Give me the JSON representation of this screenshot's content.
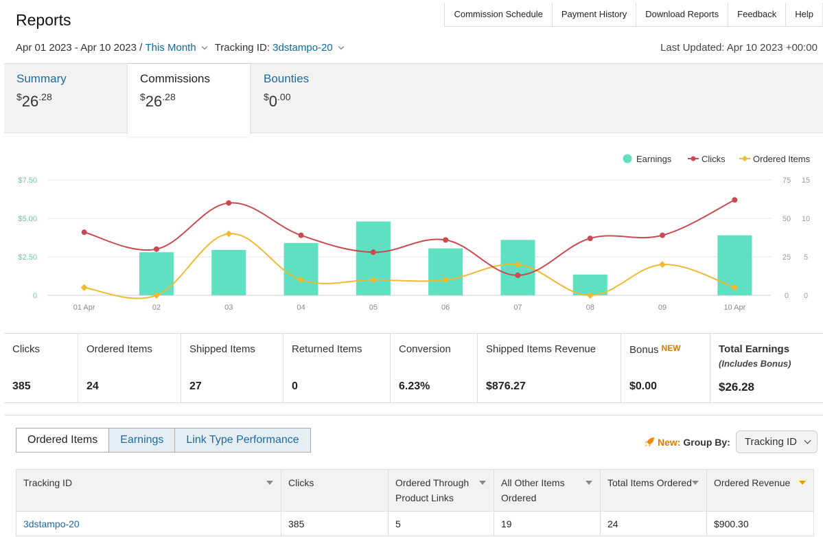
{
  "header": {
    "title": "Reports",
    "nav": [
      "Commission Schedule",
      "Payment History",
      "Download Reports",
      "Feedback",
      "Help"
    ],
    "date_range": "Apr 01 2023 - Apr 10 2023 /",
    "period": "This Month",
    "tracking_label": "Tracking ID:",
    "tracking_value": "3dstampo-20",
    "last_updated": "Last Updated: Apr 10 2023 +00:00"
  },
  "summary_tabs": [
    {
      "label": "Summary",
      "currency": "$",
      "whole": "26",
      "cents": ".28"
    },
    {
      "label": "Commissions",
      "currency": "$",
      "whole": "26",
      "cents": ".28"
    },
    {
      "label": "Bounties",
      "currency": "$",
      "whole": "0",
      "cents": ".00"
    }
  ],
  "chart_data": {
    "type": "bar",
    "categories": [
      "01 Apr",
      "02",
      "03",
      "04",
      "05",
      "06",
      "07",
      "08",
      "09",
      "10 Apr"
    ],
    "legend": [
      "Earnings",
      "Clicks",
      "Ordered Items"
    ],
    "left_axis_ticks": [
      "$7.50",
      "$5.00",
      "$2.50",
      "0"
    ],
    "mid_axis_ticks": [
      "75",
      "50",
      "25",
      "0"
    ],
    "right_axis_ticks": [
      "15",
      "10",
      "5",
      "0"
    ],
    "series": [
      {
        "name": "Earnings",
        "axis": "left",
        "kind": "bar",
        "values": [
          0,
          2.8,
          2.95,
          3.4,
          4.8,
          3.05,
          3.6,
          1.35,
          0,
          3.9
        ]
      },
      {
        "name": "Clicks",
        "axis": "mid",
        "kind": "line",
        "values": [
          41,
          30,
          60,
          39,
          28,
          36,
          13,
          37,
          39,
          62
        ]
      },
      {
        "name": "Ordered Items",
        "axis": "right",
        "kind": "line",
        "values": [
          1,
          0,
          8,
          2,
          2,
          2,
          4,
          0,
          4,
          1
        ]
      }
    ],
    "ylim_left": [
      0,
      7.5
    ],
    "ylim_mid": [
      0,
      75
    ],
    "ylim_right": [
      0,
      15
    ],
    "colors": {
      "earnings": "#5fe0c3",
      "clicks": "#c94a4f",
      "ordered": "#f0b930"
    },
    "grid": true,
    "legend_position": "top-right"
  },
  "metrics": [
    {
      "label": "Clicks",
      "value": "385"
    },
    {
      "label": "Ordered Items",
      "value": "24"
    },
    {
      "label": "Shipped Items",
      "value": "27"
    },
    {
      "label": "Returned Items",
      "value": "0"
    },
    {
      "label": "Conversion",
      "value": "6.23%"
    },
    {
      "label": "Shipped Items Revenue",
      "value": "$876.27"
    },
    {
      "label": "Bonus",
      "badge": "NEW",
      "value": "$0.00"
    },
    {
      "label": "Total Earnings",
      "sub": "(Includes Bonus)",
      "value": "$26.28"
    }
  ],
  "bottom_tabs": [
    "Ordered Items",
    "Earnings",
    "Link Type Performance"
  ],
  "group_by": {
    "new": "New:",
    "label": "Group By:",
    "value": "Tracking ID"
  },
  "table": {
    "columns": [
      "Tracking ID",
      "Clicks",
      "Ordered Through Product Links",
      "All Other Items Ordered",
      "Total Items Ordered",
      "Ordered Revenue"
    ],
    "rows": [
      [
        "3dstampo-20",
        "385",
        "5",
        "19",
        "24",
        "$900.30"
      ]
    ]
  }
}
